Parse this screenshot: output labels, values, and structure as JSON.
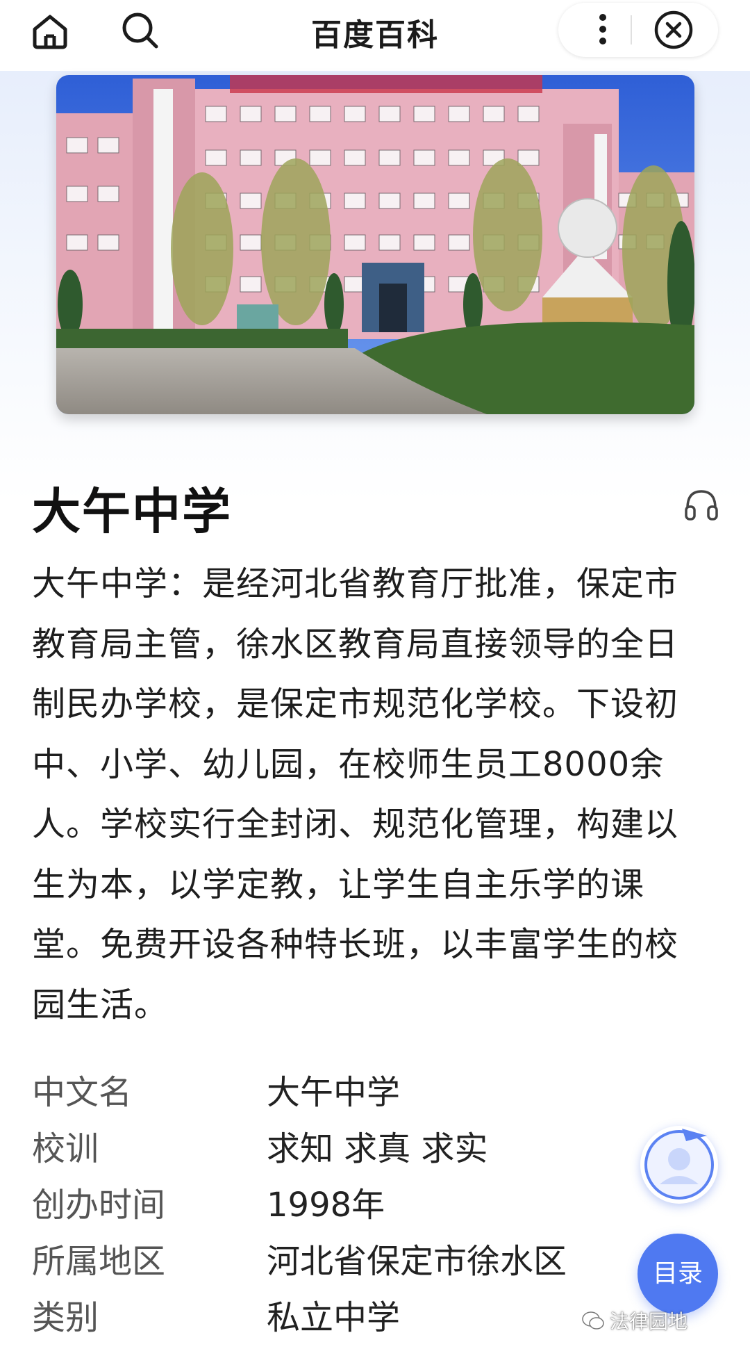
{
  "header": {
    "title": "百度百科",
    "icons": [
      "home-icon",
      "search-icon",
      "more-icon",
      "close-icon"
    ]
  },
  "hero": {
    "image_desc": "school-building-photo"
  },
  "entry": {
    "title": "大午中学",
    "summary_lines": [
      "大午中学：是经河北省教育厅批准，保定市",
      "教育局主管，徐水区教育局直接领导的全日",
      "制民办学校，是保定市规范化学校。下设初",
      "中、小学、幼儿园，在校师生员工8000余",
      "人。学校实行全封闭、规范化管理，构建以",
      "生为本，以学定教，让学生自主乐学的课",
      "堂。免费开设各种特长班，以丰富学生的校",
      "园生活。"
    ]
  },
  "info": [
    {
      "key": "中文名",
      "value": "大午中学"
    },
    {
      "key": "校训",
      "value": "求知 求真 求实"
    },
    {
      "key": "创办时间",
      "value": "1998年"
    },
    {
      "key": "所属地区",
      "value": "河北省保定市徐水区"
    },
    {
      "key": "类别",
      "value": "私立中学"
    }
  ],
  "floating": {
    "toc_label": "目录"
  },
  "watermark": "法律园地",
  "colors": {
    "accent": "#4f79f1",
    "band": "#e7eefc"
  }
}
